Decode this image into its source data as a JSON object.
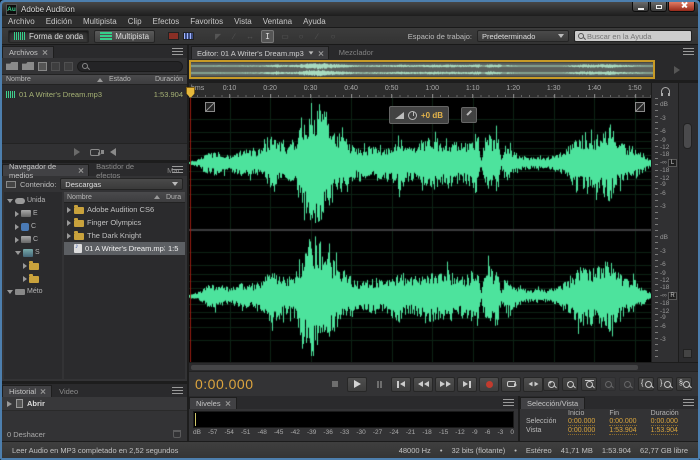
{
  "window": {
    "title": "Adobe Audition",
    "app_icon": "Au"
  },
  "menu": {
    "items": [
      "Archivo",
      "Edición",
      "Multipista",
      "Clip",
      "Efectos",
      "Favoritos",
      "Vista",
      "Ventana",
      "Ayuda"
    ]
  },
  "toolbar": {
    "waveform_button": "Forma de onda",
    "multitrack_button": "Multipista",
    "workspace_label": "Espacio de trabajo:",
    "workspace_value": "Predeterminado",
    "help_search_placeholder": "Buscar en la Ayuda"
  },
  "files_panel": {
    "tab": "Archivos",
    "columns": {
      "name": "Nombre",
      "status": "Estado",
      "duration": "Duración"
    },
    "rows": [
      {
        "name": "01 A Writer's Dream.mp3",
        "duration": "1:53.904"
      }
    ]
  },
  "media_browser": {
    "tabs": [
      "Navegador de medios",
      "Bastidor de efectos",
      "Mar"
    ],
    "content_label": "Contenido:",
    "content_value": "Descargas",
    "columns": {
      "name": "Nombre",
      "duration": "Dura"
    },
    "tree": [
      {
        "icon": "drives",
        "label": "Unida",
        "expanded": true,
        "indent": 0
      },
      {
        "icon": "drive",
        "label": "E",
        "indent": 1
      },
      {
        "icon": "user",
        "label": "C",
        "indent": 1
      },
      {
        "icon": "drive",
        "label": "C",
        "indent": 1
      },
      {
        "icon": "netdrive",
        "label": "S",
        "expanded": true,
        "indent": 1
      },
      {
        "icon": "folder",
        "label": "",
        "indent": 2
      },
      {
        "icon": "folder",
        "label": "",
        "indent": 2
      },
      {
        "icon": "shortcuts",
        "label": "Méto",
        "expanded": true,
        "indent": 0
      }
    ],
    "rows": [
      {
        "type": "folder",
        "name": "Adobe Audition CS6"
      },
      {
        "type": "folder",
        "name": "Finger Olympics"
      },
      {
        "type": "folder",
        "name": "The Dark Knight"
      },
      {
        "type": "audio",
        "name": "01 A Writer's Dream.mp3",
        "duration": "1:5",
        "selected": true
      }
    ]
  },
  "history_panel": {
    "tabs": [
      "Historial",
      "Video"
    ],
    "items": [
      {
        "label": "Abrir"
      }
    ],
    "undo_status": "0 Deshacer"
  },
  "editor": {
    "tab": "Editor: 01 A Writer's Dream.mp3",
    "mixer_tab": "Mezclador",
    "ruler_unit": "hms",
    "ruler_ticks": [
      "0:10",
      "0:20",
      "0:30",
      "0:40",
      "0:50",
      "1:00",
      "1:10",
      "1:20",
      "1:30",
      "1:40",
      "1:50"
    ],
    "hud_gain": "+0 dB",
    "db_unit": "dB",
    "db_ticks": [
      "-3",
      "-6",
      "-9",
      "-12",
      "-18"
    ],
    "db_infinity": "-∞",
    "left_badge": "L",
    "right_badge": "R"
  },
  "transport": {
    "time": "0:00.000"
  },
  "levels_panel": {
    "tab": "Niveles",
    "scale": [
      "dB",
      "-57",
      "-54",
      "-51",
      "-48",
      "-45",
      "-42",
      "-39",
      "-36",
      "-33",
      "-30",
      "-27",
      "-24",
      "-21",
      "-18",
      "-15",
      "-12",
      "-9",
      "-6",
      "-3",
      "0"
    ]
  },
  "selection_panel": {
    "tab": "Selección/Vista",
    "headers": [
      "Inicio",
      "Fin",
      "Duración"
    ],
    "rows": [
      {
        "label": "Selección",
        "values": [
          "0:00.000",
          "0:00.000",
          "0:00.000"
        ]
      },
      {
        "label": "Vista",
        "values": [
          "0:00.000",
          "1:53.904",
          "1:53.904"
        ]
      }
    ]
  },
  "status_bar": {
    "message": "Leer Audio en MP3 completado en 2,52 segundos",
    "stats": [
      "48000 Hz",
      "•",
      "32 bits (flotante)",
      "•",
      "Estéreo",
      "41,71 MB",
      "1:53.904",
      "62,77 GB libre"
    ]
  },
  "colors": {
    "waveform_green": "#4de39d",
    "accent_amber": "#d9a43c",
    "playhead_red": "#9b1c12",
    "selection_border_yellow": "#c79a26",
    "window_border_blue": "#4d7fae",
    "grid_green": "#0c2315"
  }
}
